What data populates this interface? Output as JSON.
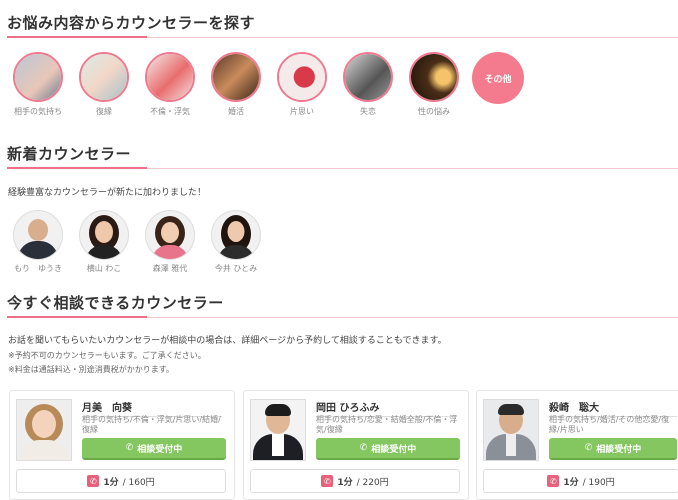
{
  "sections": {
    "by_concern": {
      "title": "お悩み内容からカウンセラーを探す"
    },
    "new_counselors": {
      "title": "新着カウンセラー",
      "intro": "経験豊富なカウンセラーが新たに加わりました！"
    },
    "available_now": {
      "title": "今すぐ相談できるカウンセラー",
      "intro": "お話を聞いてもらいたいカウンセラーが相談中の場合は、詳細ページから予約して相談することもできます。",
      "note1": "※予約不可のカウンセラーもいます。ご了承ください。",
      "note2": "※料金は通話料込・別途消費税がかかります。"
    }
  },
  "categories": [
    {
      "label": "相手の気持ち"
    },
    {
      "label": "復縁"
    },
    {
      "label": "不倫・浮気"
    },
    {
      "label": "婚活"
    },
    {
      "label": "片思い"
    },
    {
      "label": "失恋"
    },
    {
      "label": "性の悩み"
    }
  ],
  "category_other": {
    "label": "その他"
  },
  "new_list": [
    {
      "name": "もり　ゆうき"
    },
    {
      "name": "横山 わこ"
    },
    {
      "name": "森澤 雅代"
    },
    {
      "name": "今井 ひとみ"
    }
  ],
  "cards": [
    {
      "name": "月美　向葵",
      "tags": "相手の気持ち/不倫・浮気/片思い/結婚/復縁",
      "button": "相談受付中",
      "price_unit": "1分",
      "price": "/ 160円"
    },
    {
      "name": "岡田 ひろふみ",
      "tags": "相手の気持ち/恋愛・結婚全般/不倫・浮気/復縁",
      "button": "相談受付中",
      "price_unit": "1分",
      "price": "/ 220円"
    },
    {
      "name": "殺崎　聡大",
      "tags": "相手の気持ち/婚活/その他恋愛/復縁/片思い",
      "button": "相談受付中",
      "price_unit": "1分",
      "price": "/ 190円"
    }
  ]
}
